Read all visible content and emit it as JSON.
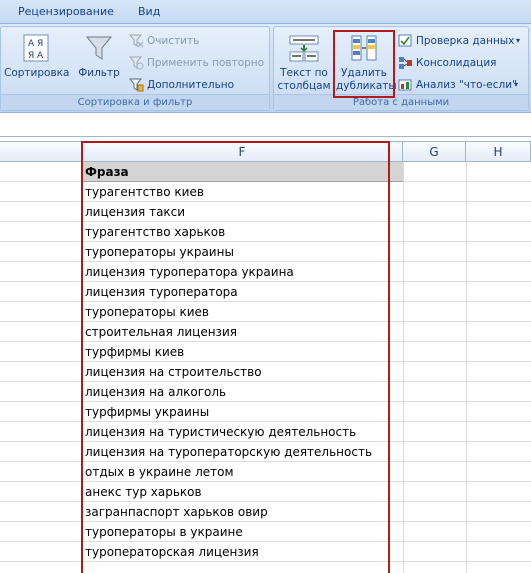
{
  "ribbon": {
    "tabs": [
      "Рецензирование",
      "Вид"
    ],
    "sort_filter": {
      "sort_label": "Сортировка",
      "filter_label": "Фильтр",
      "clear_label": "Очистить",
      "reapply_label": "Применить повторно",
      "advanced_label": "Дополнительно",
      "group_label": "Сортировка и фильтр"
    },
    "data_tools": {
      "text_to_columns_line1": "Текст по",
      "text_to_columns_line2": "столбцам",
      "remove_dup_line1": "Удалить",
      "remove_dup_line2": "дубликаты",
      "validation_label": "Проверка данных",
      "consolidation_label": "Консолидация",
      "whatif_label": "Анализ \"что-если\"",
      "group_label": "Работа с данными"
    }
  },
  "sheet": {
    "columns": [
      "F",
      "G",
      "H"
    ],
    "header_cell": "Фраза",
    "rows": [
      "турагентство киев",
      "лицензия такси",
      "турагентство харьков",
      "туроператоры украины",
      "лицензия туроператора украина",
      "лицензия туроператора",
      "туроператоры киев",
      "строительная лицензия",
      "турфирмы киев",
      "лицензия на строительство",
      "лицензия на алкоголь",
      "турфирмы украины",
      "лицензия на туристическую деятельность",
      "лицензия на туроператорскую деятельность",
      "отдых в украине летом",
      "анекс тур харьков",
      "загранпаспорт харьков овир",
      "туроператоры в украине",
      "туроператорская лицензия"
    ]
  },
  "colors": {
    "highlight": "#b01c1c",
    "ribbon_text": "#15428b"
  }
}
